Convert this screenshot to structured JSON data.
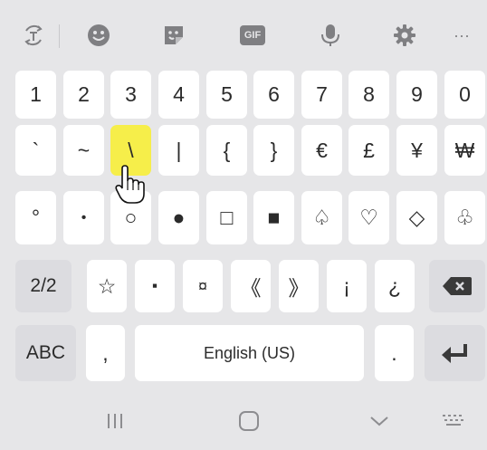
{
  "toolbar": {
    "icons": [
      "translate-icon",
      "emoji-icon",
      "sticker-icon",
      "gif-icon",
      "microphone-icon",
      "settings-icon",
      "more-icon"
    ],
    "gif_label": "GIF",
    "more_label": "···"
  },
  "rows": {
    "r1": [
      "1",
      "2",
      "3",
      "4",
      "5",
      "6",
      "7",
      "8",
      "9",
      "0"
    ],
    "r2": [
      "`",
      "~",
      "\\",
      "|",
      "{",
      "}",
      "€",
      "£",
      "¥",
      "₩"
    ],
    "r3": [
      "°",
      "•",
      "○",
      "●",
      "□",
      "■",
      "♤",
      "♡",
      "◇",
      "♧"
    ],
    "r4": [
      "☆",
      "▪",
      "¤",
      "《",
      "》",
      "¡",
      "¿"
    ],
    "r4_left": "2/2",
    "r5_left": "ABC",
    "r5_comma": ",",
    "r5_space": "English (US)",
    "r5_period": "."
  },
  "colors": {
    "highlight": "#f6ee4a",
    "key_bg": "#ffffff",
    "function_key_bg": "#dcdce0",
    "keyboard_bg": "#e6e6e8"
  },
  "navbar": {
    "icons": [
      "recent-apps-icon",
      "home-icon",
      "back-icon",
      "keyboard-switch-icon"
    ]
  }
}
